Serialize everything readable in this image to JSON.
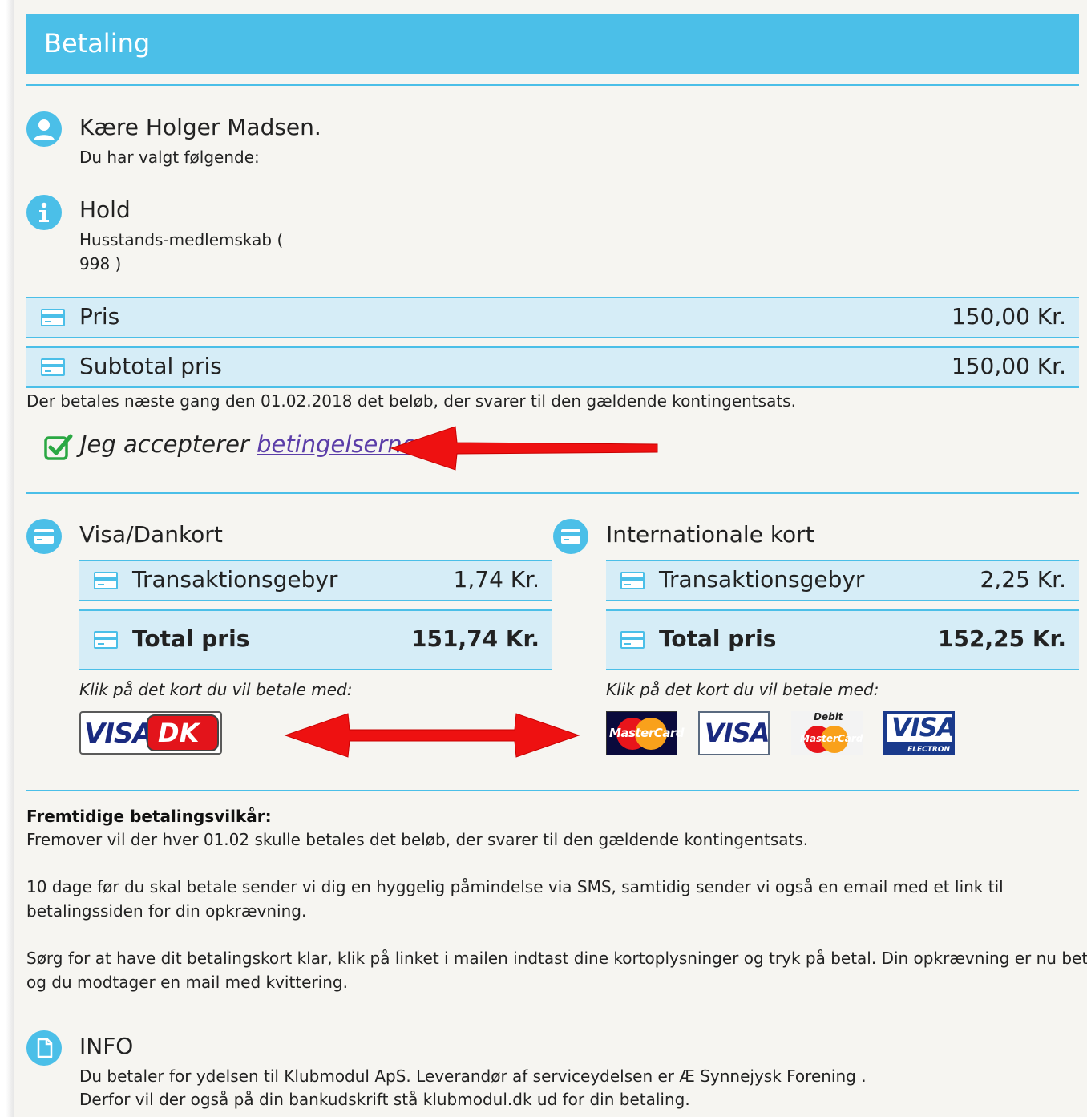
{
  "header": {
    "title": "Betaling"
  },
  "greeting": {
    "title": "Kære Holger Madsen.",
    "subtitle": "Du har valgt følgende:"
  },
  "hold": {
    "title": "Hold",
    "line1": "Husstands-medlemskab (",
    "line2": "998 )"
  },
  "pricing": {
    "price_label": "Pris",
    "price_value": "150,00  Kr.",
    "subtotal_label": "Subtotal pris",
    "subtotal_value": "150,00  Kr.",
    "next_payment_note": "Der betales næste gang den   01.02.2018 det beløb, der svarer til den gældende kontingentsats."
  },
  "terms": {
    "accept_text": "Jeg accepterer ",
    "link_text": "betingelserne",
    "checked": true
  },
  "visa_dankort": {
    "title": "Visa/Dankort",
    "fee_label": "Transaktionsgebyr",
    "fee_value": "1,74  Kr.",
    "total_label": "Total pris",
    "total_value": "151,74  Kr.",
    "instruction": "Klik på det kort du vil betale med:",
    "logo_visa": "VISA",
    "logo_dk": "DK"
  },
  "international": {
    "title": "Internationale kort",
    "fee_label": "Transaktionsgebyr",
    "fee_value": "2,25  Kr.",
    "total_label": "Total pris",
    "total_value": "152,25  Kr.",
    "instruction": "Klik på det kort du vil betale med:",
    "logo_mastercard": "MasterCard",
    "logo_visa": "VISA",
    "logo_debit_top": "Debit",
    "logo_debit_mc": "MasterCard",
    "logo_visa_electron": "VISA",
    "logo_electron_sub": "ELECTRON"
  },
  "future_terms": {
    "title": "Fremtidige betalingsvilkår:",
    "line1": "Fremover vil der hver  01.02   skulle betales det beløb, der svarer til den gældende kontingentsats.",
    "para2_line1": "10 dage før du skal betale sender vi dig en hyggelig påmindelse via SMS, samtidig sender vi også en email med et link til",
    "para2_line2": "betalingssiden for din opkrævning.",
    "para3_line1": "Sørg for at have dit betalingskort klar, klik på linket i mailen indtast dine kortoplysninger og tryk på betal. Din opkrævning er nu betalt",
    "para3_line2": "og du modtager en mail med kvittering."
  },
  "info": {
    "title": "INFO",
    "line1": "Du betaler for ydelsen til Klubmodul ApS. Leverandør af serviceydelsen er  Æ Synnejysk Forening .",
    "line2": "Derfor vil der også på din bankudskrift stå klubmodul.dk ud for din betaling."
  },
  "colors": {
    "accent": "#4bbfe8",
    "bar_bg": "#d6edf7",
    "arrow": "#ee1111",
    "check": "#2aa843"
  }
}
